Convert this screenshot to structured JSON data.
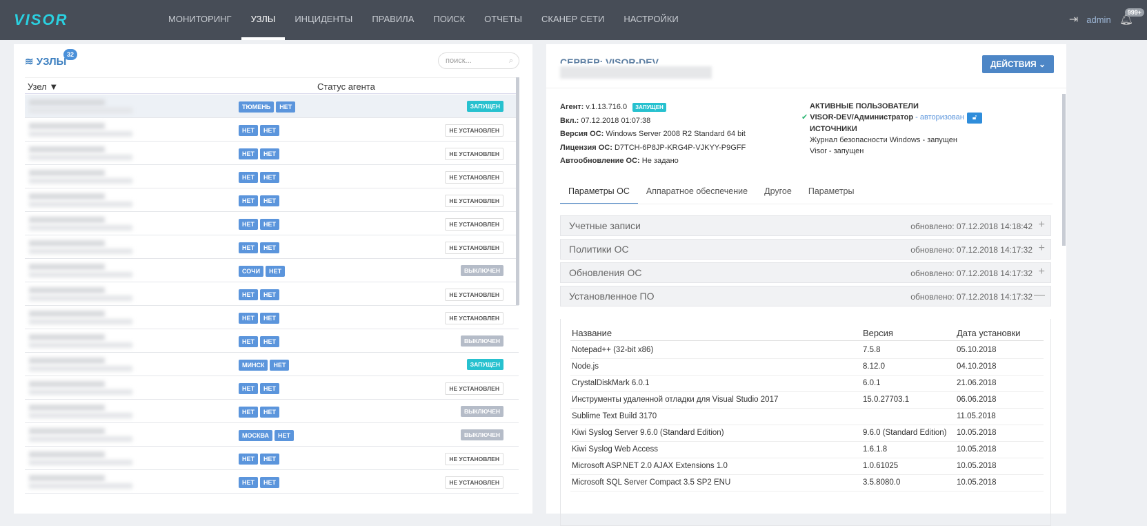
{
  "header": {
    "logo": "VISOR",
    "nav": [
      "МОНИТОРИНГ",
      "УЗЛЫ",
      "ИНЦИДЕНТЫ",
      "ПРАВИЛА",
      "ПОИСК",
      "ОТЧЕТЫ",
      "СКАНЕР СЕТИ",
      "НАСТРОЙКИ"
    ],
    "active_nav": 1,
    "user": "admin",
    "notifications": "999+"
  },
  "nodes": {
    "title": "УЗЛЫ",
    "count": "32",
    "search_placeholder": "поиск...",
    "col_node": "Узел",
    "col_status": "Статус агента",
    "rows": [
      {
        "tags": [
          "ТЮМЕНЬ",
          "НЕТ"
        ],
        "status": "ЗАПУЩЕН",
        "kind": "run"
      },
      {
        "tags": [
          "НЕТ",
          "НЕТ"
        ],
        "status": "НЕ УСТАНОВЛЕН",
        "kind": "none"
      },
      {
        "tags": [
          "НЕТ",
          "НЕТ"
        ],
        "status": "НЕ УСТАНОВЛЕН",
        "kind": "none"
      },
      {
        "tags": [
          "НЕТ",
          "НЕТ"
        ],
        "status": "НЕ УСТАНОВЛЕН",
        "kind": "none"
      },
      {
        "tags": [
          "НЕТ",
          "НЕТ"
        ],
        "status": "НЕ УСТАНОВЛЕН",
        "kind": "none"
      },
      {
        "tags": [
          "НЕТ",
          "НЕТ"
        ],
        "status": "НЕ УСТАНОВЛЕН",
        "kind": "none"
      },
      {
        "tags": [
          "НЕТ",
          "НЕТ"
        ],
        "status": "НЕ УСТАНОВЛЕН",
        "kind": "none"
      },
      {
        "tags": [
          "СОЧИ",
          "НЕТ"
        ],
        "status": "ВЫКЛЮЧЕН",
        "kind": "off"
      },
      {
        "tags": [
          "НЕТ",
          "НЕТ"
        ],
        "status": "НЕ УСТАНОВЛЕН",
        "kind": "none"
      },
      {
        "tags": [
          "НЕТ",
          "НЕТ"
        ],
        "status": "НЕ УСТАНОВЛЕН",
        "kind": "none"
      },
      {
        "tags": [
          "НЕТ",
          "НЕТ"
        ],
        "status": "ВЫКЛЮЧЕН",
        "kind": "off"
      },
      {
        "tags": [
          "МИНСК",
          "НЕТ"
        ],
        "status": "ЗАПУЩЕН",
        "kind": "run"
      },
      {
        "tags": [
          "НЕТ",
          "НЕТ"
        ],
        "status": "НЕ УСТАНОВЛЕН",
        "kind": "none"
      },
      {
        "tags": [
          "НЕТ",
          "НЕТ"
        ],
        "status": "ВЫКЛЮЧЕН",
        "kind": "off"
      },
      {
        "tags": [
          "МОСКВА",
          "НЕТ"
        ],
        "status": "ВЫКЛЮЧЕН",
        "kind": "off"
      },
      {
        "tags": [
          "НЕТ",
          "НЕТ"
        ],
        "status": "НЕ УСТАНОВЛЕН",
        "kind": "none"
      },
      {
        "tags": [
          "НЕТ",
          "НЕТ"
        ],
        "status": "НЕ УСТАНОВЛЕН",
        "kind": "none"
      }
    ]
  },
  "server": {
    "title": "СЕРВЕР: VISOR-DEV",
    "actions": "ДЕЙСТВИЯ ⌄",
    "agent_label": "Агент:",
    "agent": "v.1.13.716.0",
    "agent_status": "ЗАПУЩЕН",
    "on_label": "Вкл.:",
    "on": "07.12.2018 01:07:38",
    "os_label": "Версия ОС:",
    "os": "Windows Server 2008 R2 Standard  64 bit",
    "lic_label": "Лицензия ОС:",
    "lic": "D7TCH-6P8JP-KRG4P-VJKYY-P9GFF",
    "upd_label": "Автообновление ОС:",
    "upd": "Не задано",
    "users_title": "АКТИВНЫЕ ПОЛЬЗОВАТЕЛИ",
    "user": "VISOR-DEV/Администратор",
    "user_state": " - авторизован",
    "sources_title": "ИСТОЧНИКИ",
    "sources": [
      "Журнал безопасности Windows - запущен",
      "Visor - запущен"
    ],
    "tabs": [
      "Параметры ОС",
      "Аппаратное обеспечение",
      "Другое",
      "Параметры"
    ],
    "sections": [
      {
        "title": "Учетные записи",
        "updated": "обновлено: 07.12.2018 14:18:42",
        "toggle": "+"
      },
      {
        "title": "Политики ОС",
        "updated": "обновлено: 07.12.2018 14:17:32",
        "toggle": "+"
      },
      {
        "title": "Обновления ОС",
        "updated": "обновлено: 07.12.2018 14:17:32",
        "toggle": "+"
      },
      {
        "title": "Установленное ПО",
        "updated": "обновлено: 07.12.2018 14:17:32",
        "toggle": "—"
      }
    ],
    "software": {
      "cols": [
        "Название",
        "Версия",
        "Дата установки"
      ],
      "rows": [
        [
          "Notepad++ (32-bit x86)",
          "7.5.8",
          "05.10.2018"
        ],
        [
          "Node.js",
          "8.12.0",
          "04.10.2018"
        ],
        [
          "CrystalDiskMark 6.0.1",
          "6.0.1",
          "21.06.2018"
        ],
        [
          "Инструменты удаленной отладки для Visual Studio 2017",
          "15.0.27703.1",
          "06.06.2018"
        ],
        [
          "Sublime Text Build 3170",
          "",
          "11.05.2018"
        ],
        [
          "Kiwi Syslog Server 9.6.0 (Standard Edition)",
          "9.6.0 (Standard Edition)",
          "10.05.2018"
        ],
        [
          "Kiwi Syslog Web Access",
          "1.6.1.8",
          "10.05.2018"
        ],
        [
          "Microsoft ASP.NET 2.0 AJAX Extensions 1.0",
          "1.0.61025",
          "10.05.2018"
        ],
        [
          "Microsoft SQL Server Compact 3.5 SP2 ENU",
          "3.5.8080.0",
          "10.05.2018"
        ]
      ]
    }
  }
}
